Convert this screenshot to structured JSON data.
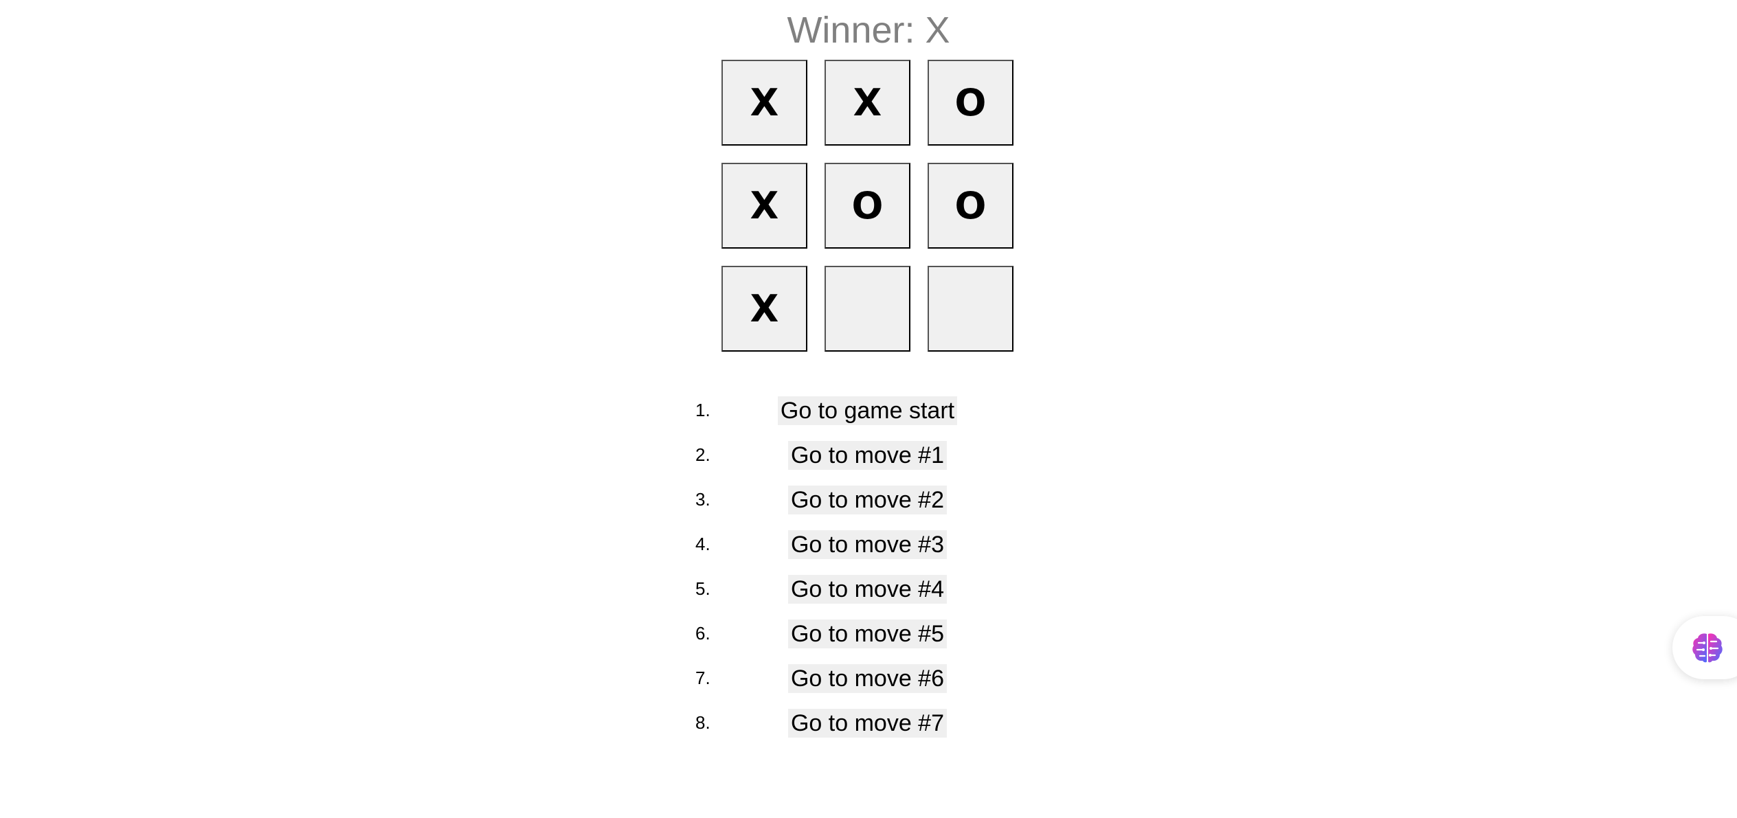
{
  "game": {
    "status": "Winner: X",
    "squares": [
      "X",
      "X",
      "O",
      "X",
      "O",
      "O",
      "X",
      "",
      ""
    ]
  },
  "history": {
    "moves": [
      {
        "number": "1.",
        "label": "Go to game start"
      },
      {
        "number": "2.",
        "label": "Go to move #1"
      },
      {
        "number": "3.",
        "label": "Go to move #2"
      },
      {
        "number": "4.",
        "label": "Go to move #3"
      },
      {
        "number": "5.",
        "label": "Go to move #4"
      },
      {
        "number": "6.",
        "label": "Go to move #5"
      },
      {
        "number": "7.",
        "label": "Go to move #6"
      },
      {
        "number": "8.",
        "label": "Go to move #7"
      }
    ]
  },
  "assistant": {
    "icon": "brain-icon",
    "gradient_start": "#ff2fb0",
    "gradient_end": "#4a6cff"
  },
  "colors": {
    "status_text": "#808080",
    "square_bg": "#f0f0f0",
    "button_bg": "#efefef"
  }
}
